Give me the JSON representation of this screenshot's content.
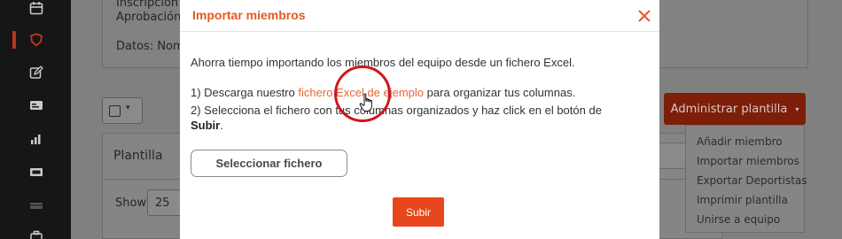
{
  "sidebar": {
    "icons": [
      "calendar-icon",
      "shield-icon",
      "edit-icon",
      "id-card-icon",
      "bar-chart-icon",
      "ticket-icon",
      "card-icon",
      "briefcase-icon"
    ],
    "active": "shield-icon",
    "accent_color": "#b8361a"
  },
  "background_page": {
    "info_lines": [
      "Inscripción d",
      "Aprobación:",
      "Datos: Nom"
    ],
    "panel_title": "Plantilla",
    "show_label": "Show",
    "show_value": "25",
    "admin_button": {
      "label": "Administrar plantilla",
      "caret": "▾"
    },
    "admin_menu": [
      "Añadir miembro",
      "Importar miembros",
      "Exportar Deportistas",
      "Imprimir plantilla",
      "Unirse a equipo"
    ]
  },
  "modal": {
    "title": "Importar miembros",
    "intro": "Ahorra tiempo importando los miembros del equipo desde un fichero Excel.",
    "step1_prefix": "1) Descarga nuestro ",
    "step1_link": "fichero Excel de ejemplo",
    "step1_suffix": " para organizar tus columnas.",
    "step2_line1": "2) Selecciona el fichero con tus columnas organizados y haz click en el botón de",
    "step2_bold": "Subir",
    "step2_end": ".",
    "select_file_label": "Seleccionar fichero",
    "submit_label": "Subir",
    "accent_color": "#e55a22",
    "submit_color": "#e8461c"
  },
  "annotation": {
    "click_highlight_color": "#d0161b"
  }
}
